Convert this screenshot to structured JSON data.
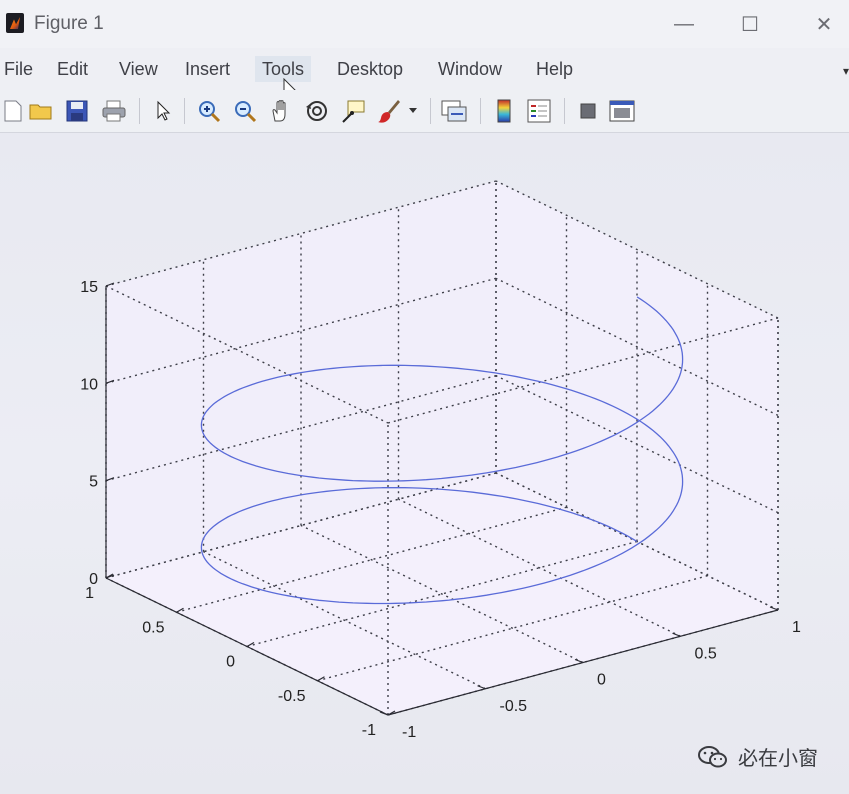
{
  "window": {
    "title": "Figure 1",
    "controls": [
      "—",
      "☐",
      "✕"
    ]
  },
  "menubar": {
    "items": [
      "File",
      "Edit",
      "View",
      "Insert",
      "Tools",
      "Desktop",
      "Window",
      "Help"
    ],
    "active": "Tools"
  },
  "toolbar": {
    "buttons": [
      "new-figure-icon",
      "open-file-icon",
      "save-icon",
      "print-icon",
      "select-arrow-icon",
      "zoom-in-icon",
      "zoom-out-icon",
      "pan-hand-icon",
      "rotate-3d-icon",
      "data-cursor-icon",
      "brush-icon",
      "link-plot-icon",
      "colorbar-icon",
      "legend-icon",
      "hide-plot-tools-icon",
      "show-plot-tools-icon"
    ]
  },
  "chart_data": {
    "type": "line",
    "projection": "3d",
    "series": [
      {
        "function": "x = sin(t), y = cos(t), z = t",
        "t_range": [
          0,
          12.566
        ],
        "color": "#5a6bd8"
      }
    ],
    "xlim": [
      -1,
      1
    ],
    "ylim": [
      -1,
      1
    ],
    "zlim": [
      0,
      15
    ],
    "xticks": [
      "-1",
      "-0.5",
      "0",
      "0.5",
      "1"
    ],
    "yticks": [
      "-1",
      "-0.5",
      "0",
      "0.5",
      "1"
    ],
    "zticks": [
      "0",
      "5",
      "10",
      "15"
    ],
    "grid": true,
    "box": true,
    "title": "",
    "xlabel": "",
    "ylabel": "",
    "zlabel": ""
  },
  "watermark": {
    "text": "必在小窗"
  }
}
